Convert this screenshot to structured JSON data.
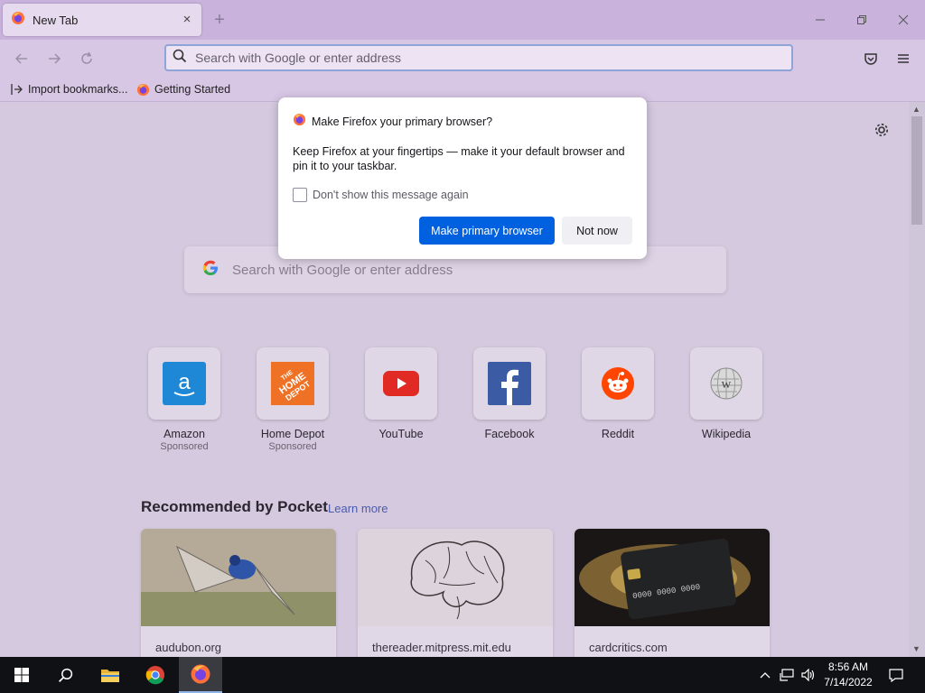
{
  "window": {
    "tab_title": "New Tab",
    "tab_close": "×",
    "new_tab": "+",
    "controls": [
      "minimize-icon",
      "restore-icon",
      "close-icon"
    ]
  },
  "toolbar": {
    "url_placeholder": "Search with Google or enter address"
  },
  "bookmarks": [
    {
      "label": "Import bookmarks...",
      "icon": "import-icon"
    },
    {
      "label": "Getting Started",
      "icon": "firefox-icon"
    }
  ],
  "newtab": {
    "search_placeholder": "Search with Google or enter address",
    "top_sites": [
      {
        "name": "Amazon",
        "sponsored": "Sponsored",
        "icon": "amazon-icon"
      },
      {
        "name": "Home Depot",
        "sponsored": "Sponsored",
        "icon": "home-depot-icon",
        "logo_text": "THE HOME DEPOT"
      },
      {
        "name": "YouTube",
        "sponsored": "",
        "icon": "youtube-icon"
      },
      {
        "name": "Facebook",
        "sponsored": "",
        "icon": "facebook-icon"
      },
      {
        "name": "Reddit",
        "sponsored": "",
        "icon": "reddit-icon"
      },
      {
        "name": "Wikipedia",
        "sponsored": "",
        "icon": "wikipedia-icon"
      }
    ],
    "pocket": {
      "title": "Recommended by Pocket",
      "learn_more": "Learn more",
      "cards": [
        {
          "source": "audubon.org",
          "image": "bird-in-flight"
        },
        {
          "source": "thereader.mitpress.mit.edu",
          "image": "puzzle-brain"
        },
        {
          "source": "cardcritics.com",
          "image": "credit-card"
        }
      ]
    }
  },
  "dialog": {
    "title": "Make Firefox your primary browser?",
    "body": "Keep Firefox at your fingertips — make it your default browser and pin it to your taskbar.",
    "checkbox_label": "Don't show this message again",
    "primary_button": "Make primary browser",
    "secondary_button": "Not now"
  },
  "taskbar": {
    "time": "8:56 AM",
    "date": "7/14/2022"
  },
  "colors": {
    "primary_button": "#0061e0",
    "accent_purple": "#c9b3dd"
  }
}
